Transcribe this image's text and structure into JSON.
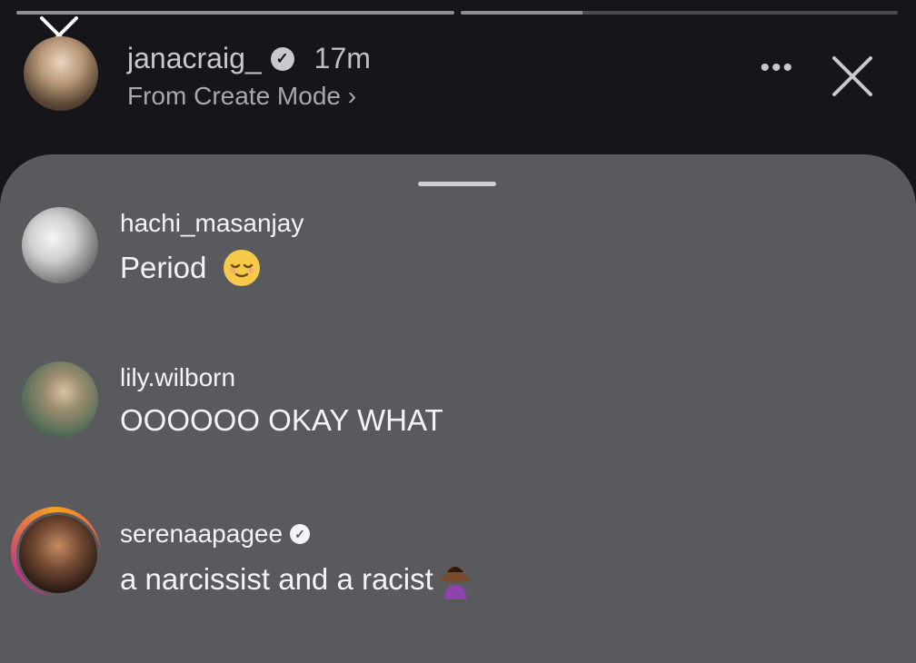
{
  "story": {
    "progress": [
      1.0,
      0.28,
      0.0
    ],
    "username": "janacraig_",
    "time": "17m",
    "subtitle": "From Create Mode ›",
    "more_label": "•••"
  },
  "comments": [
    {
      "username": "hachi_masanjay",
      "text": "Period",
      "verified": false,
      "emoji": "relieved-face"
    },
    {
      "username": "lily.wilborn",
      "text": "OOOOOO OKAY WHAT",
      "verified": false
    },
    {
      "username": "serenaapagee",
      "text": "a narcissist and a racist",
      "verified": true,
      "emoji": "person-shrugging"
    }
  ],
  "colors": {
    "background": "#16161a",
    "sheet": "#595a5e",
    "progress_fill": "#8e8e93",
    "progress_track": "#4a4a50"
  }
}
